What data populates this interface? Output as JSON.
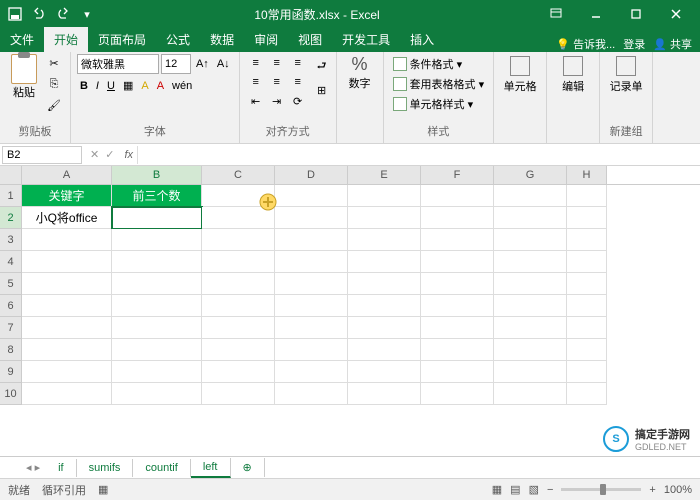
{
  "titlebar": {
    "title": "10常用函数.xlsx - Excel"
  },
  "tabs": {
    "file": "文件",
    "home": "开始",
    "layout": "页面布局",
    "formulas": "公式",
    "data": "数据",
    "review": "审阅",
    "view": "视图",
    "dev": "开发工具",
    "insert": "插入",
    "tell": "告诉我...",
    "login": "登录",
    "share": "共享"
  },
  "ribbon": {
    "paste": "粘贴",
    "clipboard": "剪贴板",
    "font_name": "微软雅黑",
    "font_size": "12",
    "font": "字体",
    "align": "对齐方式",
    "number": "数字",
    "styles": "样式",
    "cond": "条件格式",
    "table": "套用表格格式",
    "cellstyle": "单元格样式",
    "cells": "单元格",
    "edit": "编辑",
    "record": "记录单",
    "newgroup": "新建组"
  },
  "namebox": "B2",
  "cells": {
    "a1": "关键字",
    "b1": "前三个数",
    "a2": "小Q将office"
  },
  "cols": [
    "A",
    "B",
    "C",
    "D",
    "E",
    "F",
    "G",
    "H"
  ],
  "rows": [
    "1",
    "2",
    "3",
    "4",
    "5",
    "6",
    "7",
    "8",
    "9",
    "10"
  ],
  "sheets": {
    "if": "if",
    "sumifs": "sumifs",
    "countif": "countif",
    "left": "left"
  },
  "status": {
    "ready": "就绪",
    "circ": "循环引用",
    "zoom": "100%"
  },
  "watermark": {
    "text": "搞定手游网",
    "sub": "GDLED.NET"
  }
}
